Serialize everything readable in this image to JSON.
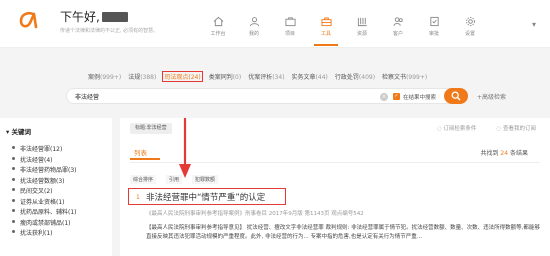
{
  "colors": {
    "accent": "#f07a1a",
    "highlight": "#e53935"
  },
  "header": {
    "greeting": "下午好,",
    "subline": "传递个法律和法律的不公正, 必须有的智慧。"
  },
  "nav": [
    {
      "label": "工作台",
      "icon": "home-icon"
    },
    {
      "label": "我的",
      "icon": "user-icon"
    },
    {
      "label": "项目",
      "icon": "briefcase-icon"
    },
    {
      "label": "工具",
      "icon": "toolbox-icon",
      "active": true
    },
    {
      "label": "资源",
      "icon": "library-icon"
    },
    {
      "label": "客户",
      "icon": "contacts-icon"
    },
    {
      "label": "审批",
      "icon": "approval-icon"
    },
    {
      "label": "设置",
      "icon": "settings-icon"
    }
  ],
  "tabs": [
    {
      "label": "案例",
      "count": "(999+)"
    },
    {
      "label": "法规",
      "count": "(388)"
    },
    {
      "label": "司法观点",
      "count": "(24)",
      "highlight": true
    },
    {
      "label": "类案同判",
      "count": "(0)"
    },
    {
      "label": "优案评析",
      "count": "(34)"
    },
    {
      "label": "实务文章",
      "count": "(44)"
    },
    {
      "label": "行政处罚",
      "count": "(409)"
    },
    {
      "label": "检察文书",
      "count": "(999+)"
    }
  ],
  "search": {
    "query": "非法经营",
    "option_label": "在结果中搜索",
    "advanced": "高级检索"
  },
  "left": {
    "title": "关键词",
    "items": [
      "非法经营罪(12)",
      "扰法经营(4)",
      "非法经营药物品罪(3)",
      "扰法经营数额(3)",
      "民间交叉(2)",
      "证券从业资格(1)",
      "扰药品原料、辅料(1)",
      "瘦肉或禁部铺品(1)",
      "扰法获利(1)"
    ]
  },
  "main": {
    "chip": "标题:非法经营",
    "actions": [
      "订阅检索条件",
      "查看我的订阅"
    ],
    "list_tab": "列表",
    "total_prefix": "共找到",
    "total_count": "24",
    "total_suffix": "条结果",
    "filters": [
      "综合排序",
      "引用",
      "犯罪数额"
    ],
    "result": {
      "index": "1",
      "title": "非法经营罪中“情节严重”的认定",
      "meta": "《最高人民法院刑事审判参考指导案例》刑事卷目    2017年9月版    第1143页    观点编号542",
      "desc": "【最高人民法院刑事审判参考指导意见】 扰法经营、擅改文字非法经营罪 裁判规则: 非法经营罪属于情节犯。扰法经营数额、数量、次数、违法所得数额等,都能够直接反映其违法犯罪活动规模的严重程度。此外, 非法经营的行为... 专案中指的危害,也是认定有关行为情节严重..."
    }
  }
}
